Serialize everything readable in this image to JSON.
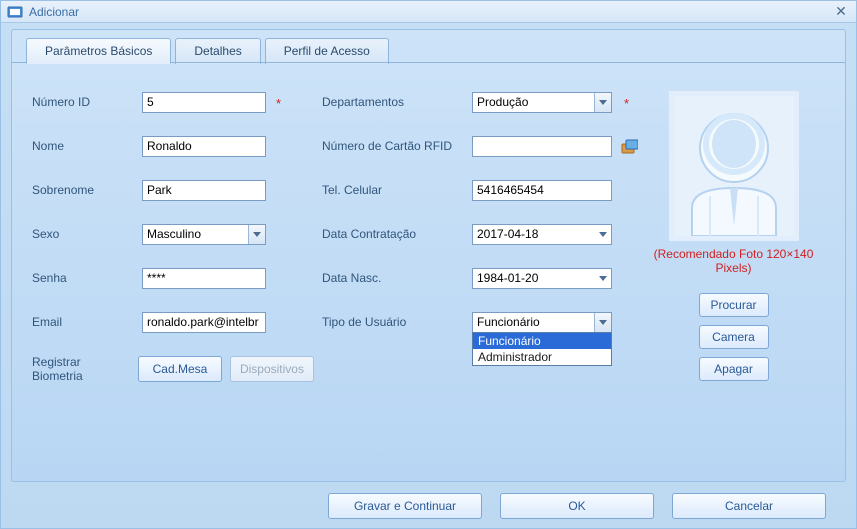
{
  "window": {
    "title": "Adicionar"
  },
  "tabs": {
    "basic": "Parâmetros Básicos",
    "details": "Detalhes",
    "access": "Perfil de Acesso"
  },
  "labels": {
    "numero_id": "Número ID",
    "nome": "Nome",
    "sobrenome": "Sobrenome",
    "sexo": "Sexo",
    "senha": "Senha",
    "email": "Email",
    "registrar_biometria": "Registrar Biometria",
    "departamentos": "Departamentos",
    "numero_cartao": "Número de Cartão RFID",
    "tel_celular": "Tel. Celular",
    "data_contratacao": "Data Contratação",
    "data_nasc": "Data Nasc.",
    "tipo_usuario": "Tipo de Usuário"
  },
  "values": {
    "numero_id": "5",
    "nome": "Ronaldo",
    "sobrenome": "Park",
    "sexo": "Masculino",
    "senha": "****",
    "email": "ronaldo.park@intelbr",
    "departamentos": "Produção",
    "numero_cartao": "",
    "tel_celular": "5416465454",
    "data_contratacao": "2017-04-18",
    "data_nasc": "1984-01-20",
    "tipo_usuario": "Funcionário"
  },
  "tipo_usuario_options": [
    "Funcionário",
    "Administrador"
  ],
  "buttons": {
    "cad_mesa": "Cad.Mesa",
    "dispositivos": "Dispositivos",
    "procurar": "Procurar",
    "camera": "Camera",
    "apagar": "Apagar",
    "gravar": "Gravar e Continuar",
    "ok": "OK",
    "cancelar": "Cancelar"
  },
  "photo": {
    "caption": "(Recomendado Foto 120×140 Pixels)"
  },
  "required_marker": "*"
}
